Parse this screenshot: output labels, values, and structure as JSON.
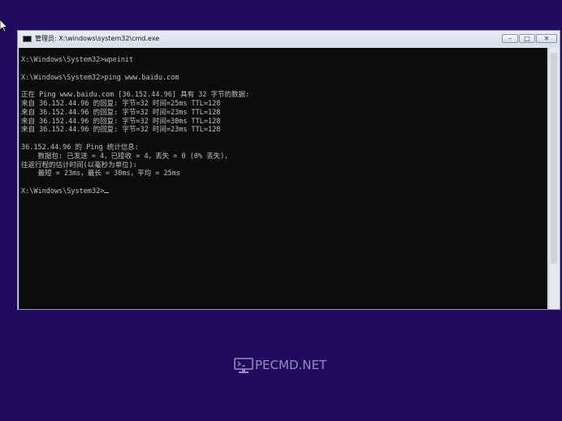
{
  "window": {
    "title": "管理员: X:\\windows\\system32\\cmd.exe",
    "min_glyph": "–",
    "max_glyph": "□",
    "close_glyph": "✕"
  },
  "console": {
    "lines": [
      "X:\\Windows\\System32>wpeinit",
      "",
      "X:\\Windows\\System32>ping www.baidu.com",
      "",
      "正在 Ping www.baidu.com [36.152.44.96] 具有 32 字节的数据:",
      "来自 36.152.44.96 的回复: 字节=32 时间=25ms TTL=128",
      "来自 36.152.44.96 的回复: 字节=32 时间=23ms TTL=128",
      "来自 36.152.44.96 的回复: 字节=32 时间=30ms TTL=128",
      "来自 36.152.44.96 的回复: 字节=32 时间=23ms TTL=128",
      "",
      "36.152.44.96 的 Ping 统计信息:",
      "    数据包: 已发送 = 4，已接收 = 4，丢失 = 0 (0% 丢失)，",
      "往返行程的估计时间(以毫秒为单位):",
      "    最短 = 23ms，最长 = 30ms，平均 = 25ms",
      "",
      "X:\\Windows\\System32>"
    ]
  },
  "brand": {
    "text": "PECMD.NET",
    "icon": "monitor-icon"
  },
  "colors": {
    "desktop": "#200b5f",
    "console_bg": "#0c0c0c",
    "console_fg": "#c0c0c0",
    "brand": "#8f8fb8"
  }
}
